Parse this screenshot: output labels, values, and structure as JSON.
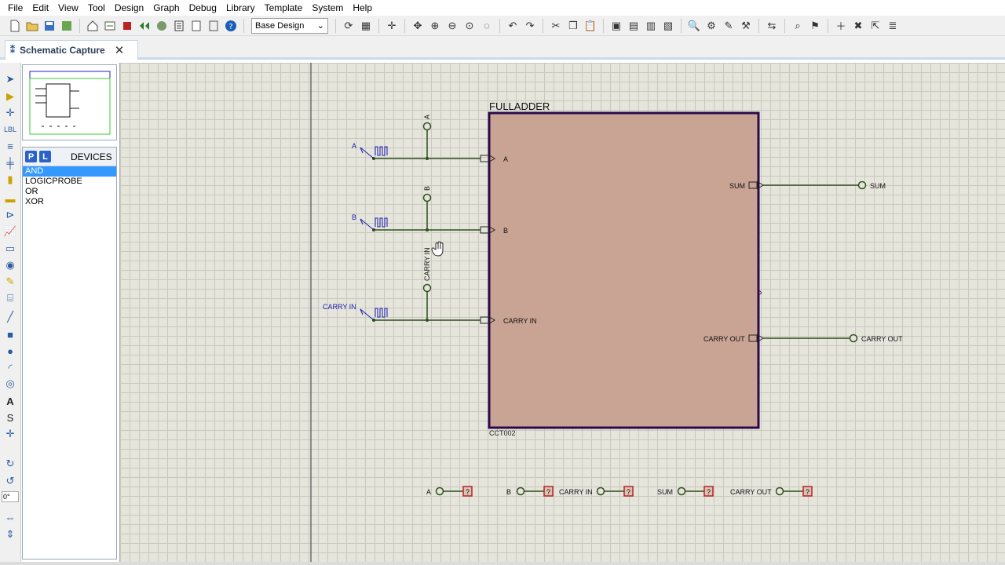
{
  "menu": [
    "File",
    "Edit",
    "View",
    "Tool",
    "Design",
    "Graph",
    "Debug",
    "Library",
    "Template",
    "System",
    "Help"
  ],
  "toolbar": {
    "design_select": "Base Design"
  },
  "tab": {
    "label": "Schematic Capture",
    "close": "✕"
  },
  "devices": {
    "header": "DEVICES",
    "p_label": "P",
    "l_label": "L",
    "items": [
      "AND",
      "LOGICPROBE",
      "OR",
      "XOR"
    ],
    "selected": "AND"
  },
  "rotation": "0°",
  "schematic": {
    "block_title": "FULLADDER",
    "block_ref": "CCT002",
    "block_fill": "#c9a393",
    "block_border": "#2a0a4a",
    "wire_color": "#2f4f1f",
    "label_color": "#1a1ab0",
    "inputs": {
      "a_gen": "A",
      "b_gen": "B",
      "cin_gen": "CARRY IN"
    },
    "input_terminals": {
      "a": "A",
      "b": "B",
      "cin": "CARRY IN"
    },
    "block_pins_in": {
      "a": "A",
      "b": "B",
      "cin": "CARRY IN"
    },
    "block_pins_out": {
      "sum": "SUM",
      "cout": "CARRY OUT"
    },
    "output_terminals": {
      "sum": "SUM",
      "cout": "CARRY OUT"
    },
    "probes": [
      "A",
      "B",
      "CARRY IN",
      "SUM",
      "CARRY OUT"
    ],
    "probe_mark": "?"
  }
}
